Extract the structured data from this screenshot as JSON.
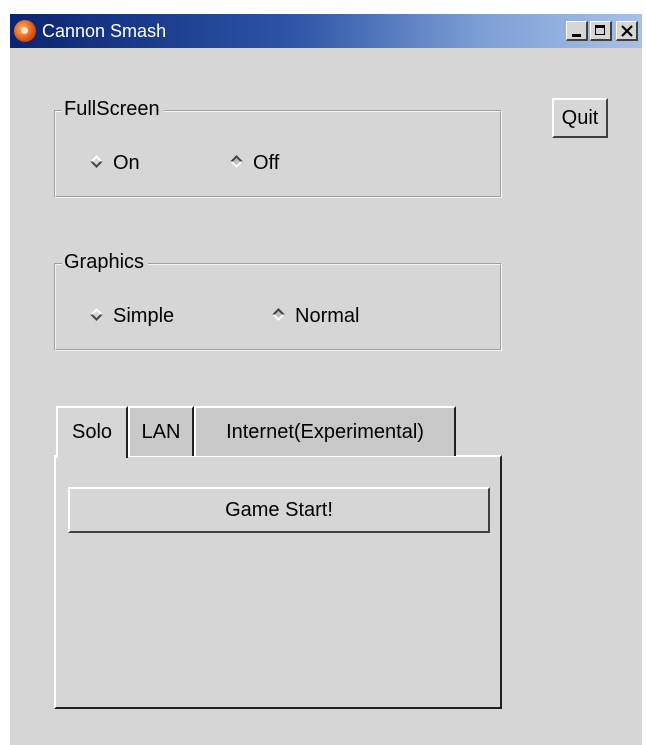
{
  "window": {
    "title": "Cannon Smash",
    "icon": "cannon-smash-app-icon",
    "controls": [
      "minimize-icon",
      "maximize-icon",
      "close-icon"
    ]
  },
  "fullscreen": {
    "label": "FullScreen",
    "options": [
      {
        "label": "On",
        "selected": false
      },
      {
        "label": "Off",
        "selected": true
      }
    ]
  },
  "graphics": {
    "label": "Graphics",
    "options": [
      {
        "label": "Simple",
        "selected": false
      },
      {
        "label": "Normal",
        "selected": true
      }
    ]
  },
  "quit_label": "Quit",
  "tabs": [
    {
      "label": "Solo",
      "active": true
    },
    {
      "label": "LAN",
      "active": false
    },
    {
      "label": "Internet(Experimental)",
      "active": false
    }
  ],
  "solo_panel": {
    "start_label": "Game Start!"
  }
}
